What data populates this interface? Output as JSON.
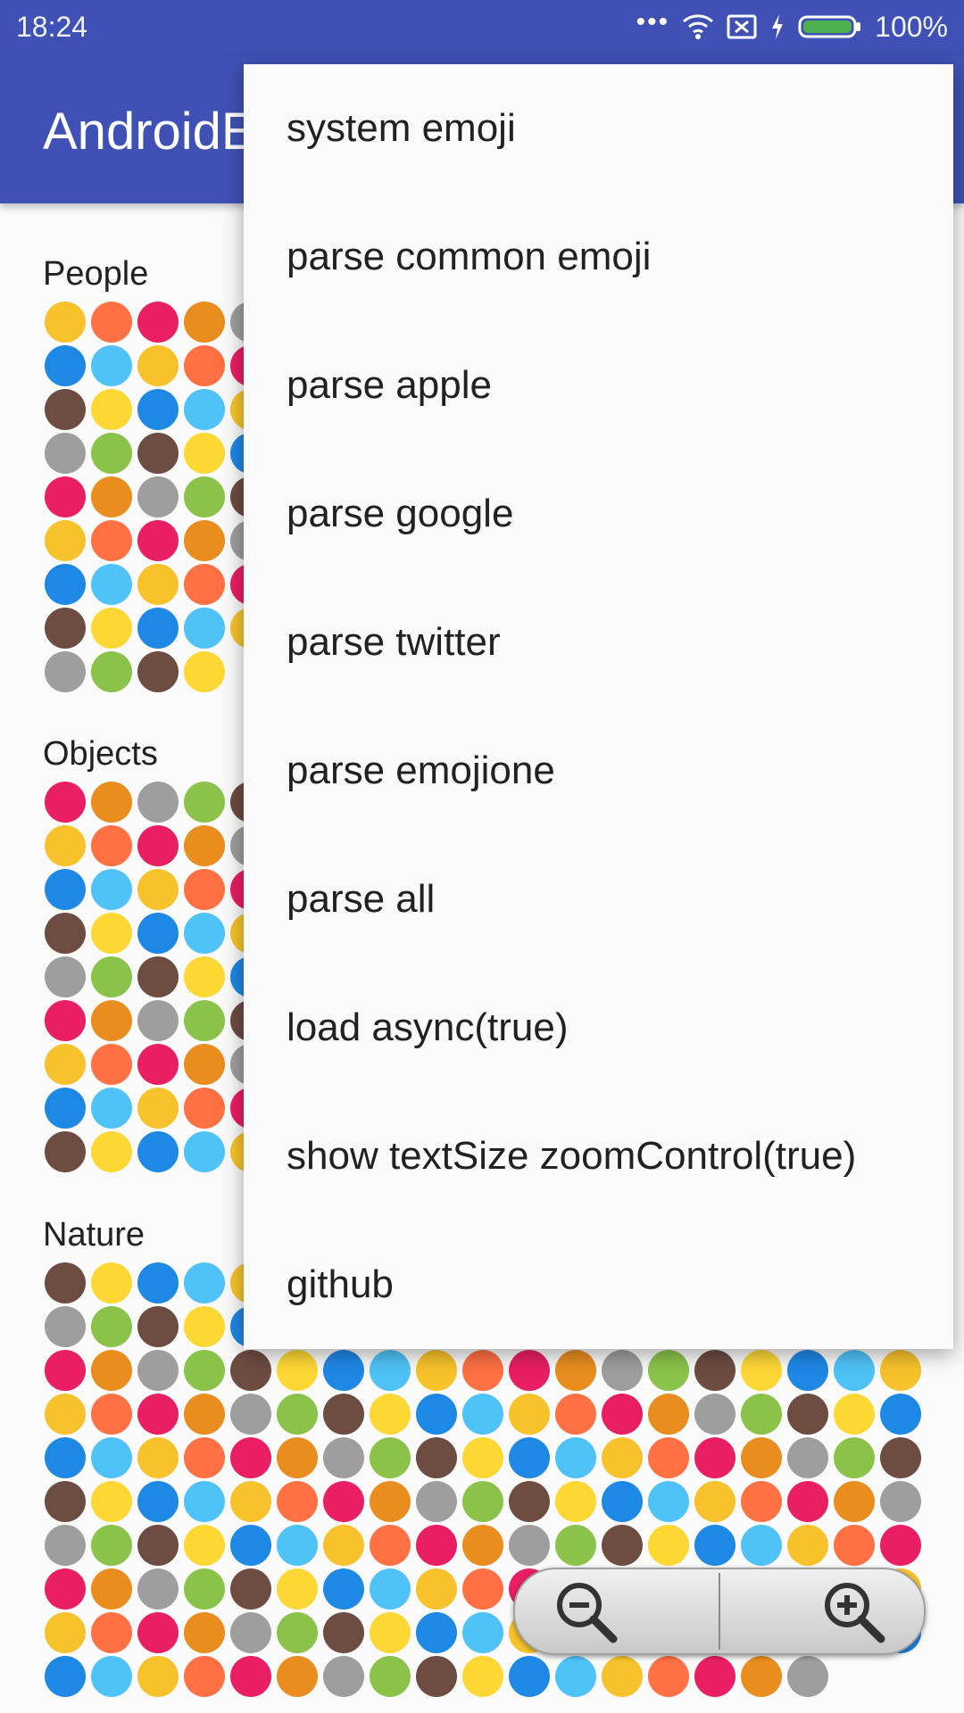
{
  "status_bar": {
    "time": "18:24",
    "battery": "100%",
    "icons": [
      "more-dots-icon",
      "wifi-icon",
      "sim-off-icon",
      "charging-icon",
      "battery-icon"
    ]
  },
  "toolbar": {
    "title": "AndroidEmoji"
  },
  "sections": [
    {
      "title": "People"
    },
    {
      "title": "Objects"
    },
    {
      "title": "Nature"
    }
  ],
  "menu": {
    "items": [
      "system emoji",
      "parse common emoji",
      "parse apple",
      "parse google",
      "parse twitter",
      "parse emojione",
      "parse all",
      "load async(true)",
      "show textSize zoomControl(true)",
      "github"
    ]
  },
  "zoom_control": {
    "icons": [
      "zoom-out-icon",
      "zoom-in-icon"
    ]
  },
  "colors": {
    "primary": "#3f51b5",
    "emoji_palette": [
      "#f7c22b",
      "#e88d1e",
      "#6d4c41",
      "#4fc3f7",
      "#e91e63",
      "#8bc34a",
      "#1e88e5",
      "#ff7043",
      "#9e9e9e",
      "#fdd835"
    ]
  }
}
